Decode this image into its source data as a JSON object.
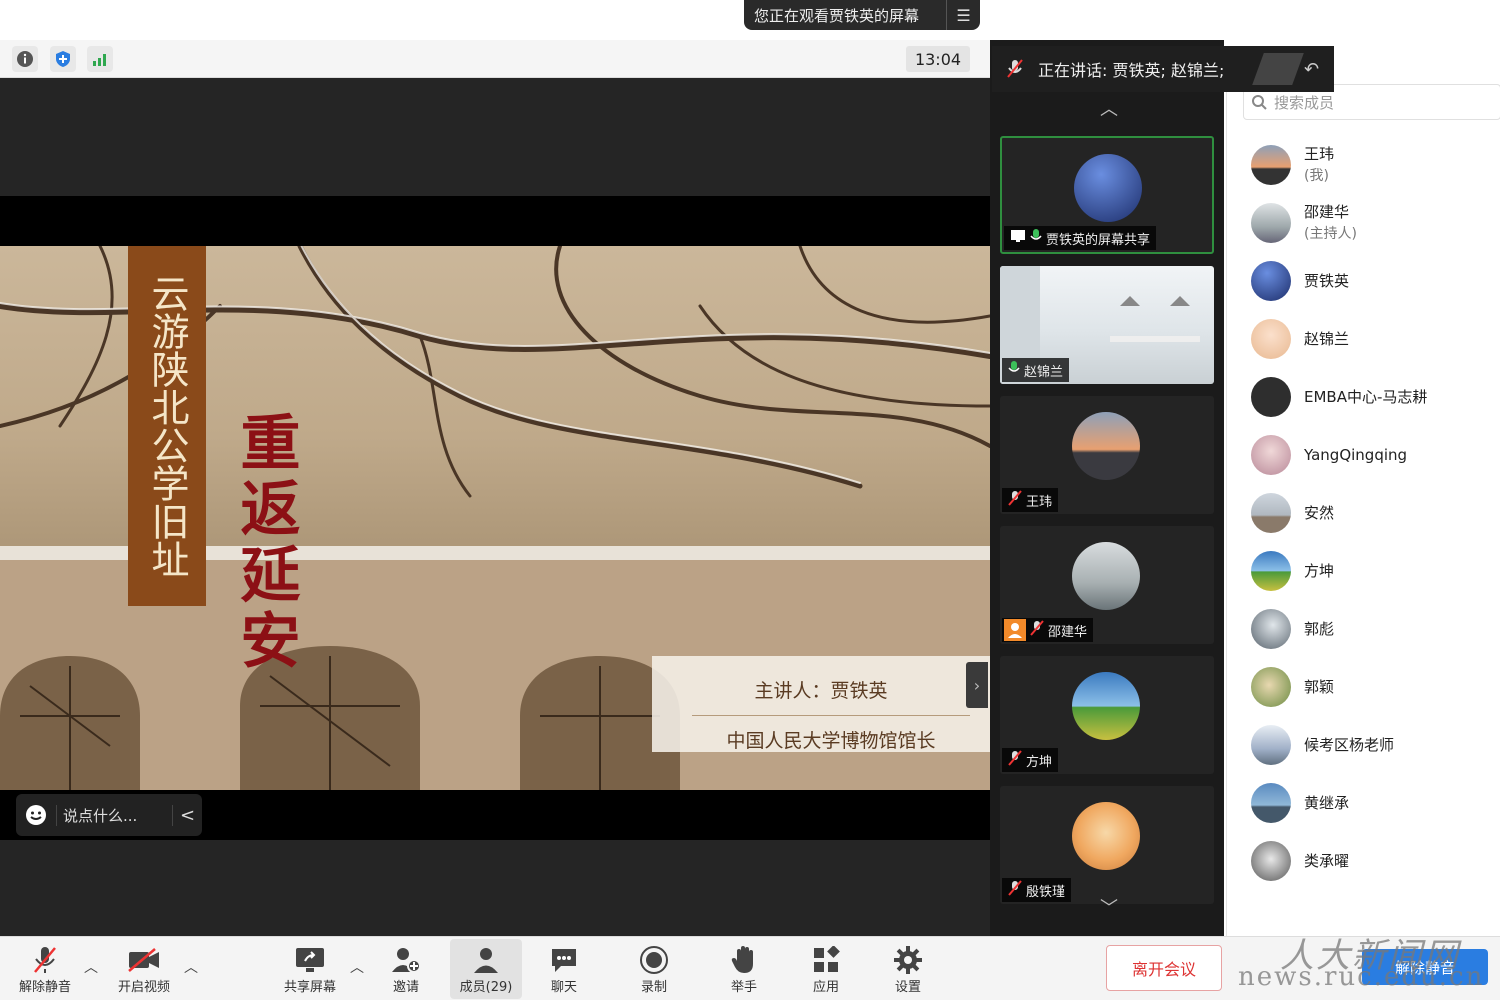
{
  "share_banner": {
    "text": "您正在观看贾铁英的屏幕"
  },
  "topbar": {
    "time": "13:04"
  },
  "slide": {
    "vertical_title": "云游陕北公学旧址",
    "red_title": "重返延安",
    "speaker_line": "主讲人：贾铁英",
    "org_line": "中国人民大学博物馆馆长"
  },
  "comment": {
    "placeholder": "说点什么...",
    "arrow": "<"
  },
  "talking": {
    "text": "正在讲话: 贾铁英; 赵锦兰;"
  },
  "gallery": {
    "tiles": [
      {
        "name": "贾铁英的屏幕共享",
        "color": "#3a4d9a"
      },
      {
        "name": "赵锦兰",
        "color": "#d8dde0"
      },
      {
        "name": "王玮",
        "color": "#c88a5a"
      },
      {
        "name": "邵建华",
        "color": "#9aa6a8"
      },
      {
        "name": "方坤",
        "color": "#3b7ac0"
      },
      {
        "name": "殷铁瑾",
        "color": "#f2c088"
      }
    ]
  },
  "panel": {
    "search_placeholder": "搜索成员",
    "participants": [
      {
        "name": "王玮",
        "sub": "(我)",
        "color": "#d09060"
      },
      {
        "name": "邵建华",
        "sub": "(主持人)",
        "color": "#9ea8ab"
      },
      {
        "name": "贾铁英",
        "sub": "",
        "color": "#3a4d9a"
      },
      {
        "name": "赵锦兰",
        "sub": "",
        "color": "#f0c8a8"
      },
      {
        "name": "EMBA中心-马志耕",
        "sub": "",
        "color": "#333333"
      },
      {
        "name": "YangQingqing",
        "sub": "",
        "color": "#c8a0a8"
      },
      {
        "name": "安然",
        "sub": "",
        "color": "#b8c0c8"
      },
      {
        "name": "方坤",
        "sub": "",
        "color": "#3b7ac0"
      },
      {
        "name": "郭彪",
        "sub": "",
        "color": "#6a7a8a"
      },
      {
        "name": "郭颖",
        "sub": "",
        "color": "#8aa060"
      },
      {
        "name": "候考区杨老师",
        "sub": "",
        "color": "#a0b0c8"
      },
      {
        "name": "黄继承",
        "sub": "",
        "color": "#5a7aa0"
      },
      {
        "name": "类承曜",
        "sub": "",
        "color": "#777777"
      }
    ]
  },
  "toolbar": {
    "unmute": "解除静音",
    "start_video": "开启视频",
    "share_screen": "共享屏幕",
    "invite": "邀请",
    "members": "成员(29)",
    "chat": "聊天",
    "record": "录制",
    "raise_hand": "举手",
    "apps": "应用",
    "settings": "设置",
    "leave": "离开会议",
    "unmute_all": "解除静音"
  },
  "watermark": {
    "line1": "人大新闻网",
    "line2": "news.ruc.edu.cn"
  },
  "colors": {
    "accent": "#2a7de1",
    "leave": "#d33333",
    "active_tile": "#2f8f3f"
  }
}
